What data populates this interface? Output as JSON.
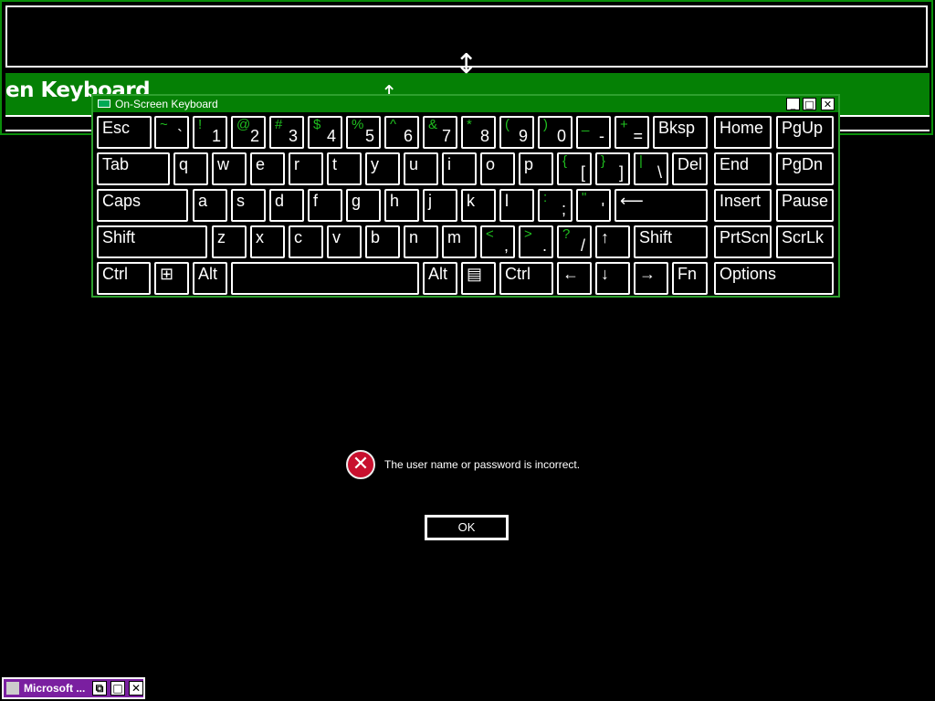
{
  "background_window": {
    "title_fragment": "en Keyboard"
  },
  "osk": {
    "title": "On-Screen Keyboard",
    "controls": [
      "_",
      "□",
      "✕"
    ],
    "keys": [
      {
        "id": "esc",
        "label": "Esc"
      },
      {
        "id": "tilde",
        "shift": "~",
        "main": "`"
      },
      {
        "id": "k1",
        "shift": "!",
        "main": "1"
      },
      {
        "id": "k2",
        "shift": "@",
        "main": "2"
      },
      {
        "id": "k3",
        "shift": "#",
        "main": "3"
      },
      {
        "id": "k4",
        "shift": "$",
        "main": "4"
      },
      {
        "id": "k5",
        "shift": "%",
        "main": "5"
      },
      {
        "id": "k6",
        "shift": "^",
        "main": "6"
      },
      {
        "id": "k7",
        "shift": "&",
        "main": "7"
      },
      {
        "id": "k8",
        "shift": "*",
        "main": "8"
      },
      {
        "id": "k9",
        "shift": "(",
        "main": "9"
      },
      {
        "id": "k0",
        "shift": ")",
        "main": "0"
      },
      {
        "id": "minus",
        "shift": "_",
        "main": "-"
      },
      {
        "id": "equals",
        "shift": "+",
        "main": "="
      },
      {
        "id": "bksp",
        "label": "Bksp"
      },
      {
        "id": "home",
        "label": "Home"
      },
      {
        "id": "pgup",
        "label": "PgUp"
      },
      {
        "id": "tab",
        "label": "Tab"
      },
      {
        "id": "q",
        "label": "q"
      },
      {
        "id": "w",
        "label": "w"
      },
      {
        "id": "e",
        "label": "e"
      },
      {
        "id": "r",
        "label": "r"
      },
      {
        "id": "t",
        "label": "t"
      },
      {
        "id": "y",
        "label": "y"
      },
      {
        "id": "u",
        "label": "u"
      },
      {
        "id": "i",
        "label": "i"
      },
      {
        "id": "o",
        "label": "o"
      },
      {
        "id": "p",
        "label": "p"
      },
      {
        "id": "lbrace",
        "shift": "{",
        "main": "["
      },
      {
        "id": "rbrace",
        "shift": "}",
        "main": "]"
      },
      {
        "id": "pipe",
        "shift": "|",
        "main": "\\"
      },
      {
        "id": "del",
        "label": "Del"
      },
      {
        "id": "end",
        "label": "End"
      },
      {
        "id": "pgdn",
        "label": "PgDn"
      },
      {
        "id": "caps",
        "label": "Caps"
      },
      {
        "id": "a",
        "label": "a"
      },
      {
        "id": "s",
        "label": "s"
      },
      {
        "id": "d",
        "label": "d"
      },
      {
        "id": "f",
        "label": "f"
      },
      {
        "id": "g",
        "label": "g"
      },
      {
        "id": "h",
        "label": "h"
      },
      {
        "id": "j",
        "label": "j"
      },
      {
        "id": "k",
        "label": "k"
      },
      {
        "id": "l",
        "label": "l"
      },
      {
        "id": "semi",
        "shift": ":",
        "main": ";"
      },
      {
        "id": "quote",
        "shift": "\"",
        "main": "'"
      },
      {
        "id": "enter",
        "label": "⟵"
      },
      {
        "id": "insert",
        "label": "Insert"
      },
      {
        "id": "pause",
        "label": "Pause"
      },
      {
        "id": "lshift",
        "label": "Shift"
      },
      {
        "id": "z",
        "label": "z"
      },
      {
        "id": "x",
        "label": "x"
      },
      {
        "id": "c",
        "label": "c"
      },
      {
        "id": "v",
        "label": "v"
      },
      {
        "id": "b",
        "label": "b"
      },
      {
        "id": "n",
        "label": "n"
      },
      {
        "id": "m",
        "label": "m"
      },
      {
        "id": "comma",
        "shift": "<",
        "main": ","
      },
      {
        "id": "period",
        "shift": ">",
        "main": "."
      },
      {
        "id": "slash",
        "shift": "?",
        "main": "/"
      },
      {
        "id": "up",
        "label": "↑"
      },
      {
        "id": "rshift",
        "label": "Shift"
      },
      {
        "id": "prtscn",
        "label": "PrtScn"
      },
      {
        "id": "scrlk",
        "label": "ScrLk"
      },
      {
        "id": "lctrl",
        "label": "Ctrl"
      },
      {
        "id": "win",
        "label": "⊞"
      },
      {
        "id": "lalt",
        "label": "Alt"
      },
      {
        "id": "space",
        "label": ""
      },
      {
        "id": "ralt",
        "label": "Alt"
      },
      {
        "id": "menu",
        "label": "▤"
      },
      {
        "id": "rctrl",
        "label": "Ctrl"
      },
      {
        "id": "left",
        "label": "←"
      },
      {
        "id": "down",
        "label": "↓"
      },
      {
        "id": "right",
        "label": "→"
      },
      {
        "id": "fn",
        "label": "Fn"
      },
      {
        "id": "options",
        "label": "Options"
      }
    ]
  },
  "dialog": {
    "icon": "error-icon",
    "message": "The user name or password is incorrect.",
    "ok_label": "OK"
  },
  "minimized_window": {
    "title": "Microsoft ...",
    "controls": [
      "⧉",
      "□",
      "✕"
    ]
  },
  "colors": {
    "accent_green": "#058005",
    "shift_green": "#1fbf1f",
    "error_red": "#c8102e"
  }
}
